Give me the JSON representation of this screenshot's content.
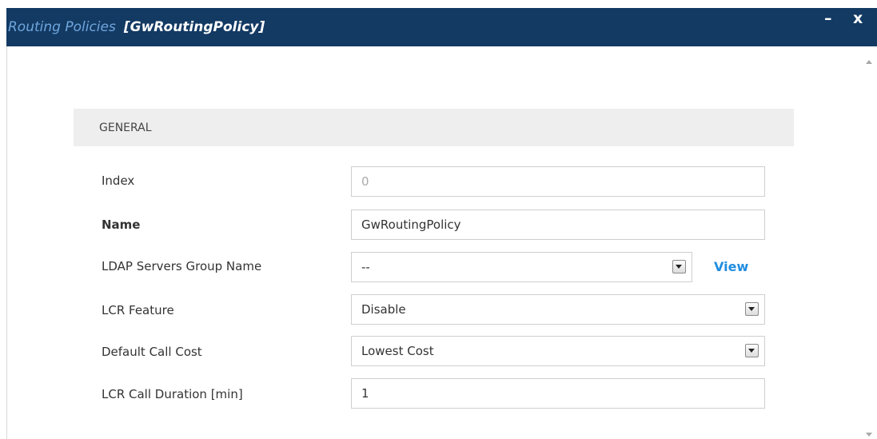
{
  "window": {
    "title": "Routing Policies",
    "record_name": "[GwRoutingPolicy]",
    "minimize_label": "–",
    "close_label": "x"
  },
  "section": {
    "title": "GENERAL"
  },
  "fields": {
    "index": {
      "label": "Index",
      "value": "0"
    },
    "name": {
      "label": "Name",
      "value": "GwRoutingPolicy"
    },
    "ldap_group": {
      "label": "LDAP Servers Group Name",
      "value": "--",
      "view_label": "View"
    },
    "lcr_feature": {
      "label": "LCR Feature",
      "value": "Disable"
    },
    "default_call_cost": {
      "label": "Default Call Cost",
      "value": "Lowest Cost"
    },
    "lcr_call_duration": {
      "label": "LCR Call Duration [min]",
      "value": "1"
    }
  },
  "colors": {
    "titlebar": "#133a63",
    "title_text": "#6fa6de",
    "link": "#1f8de0"
  },
  "icons": {
    "dropdown": "chevron-down-icon",
    "scroll_up": "scroll-up-icon",
    "scroll_down": "scroll-down-icon"
  }
}
